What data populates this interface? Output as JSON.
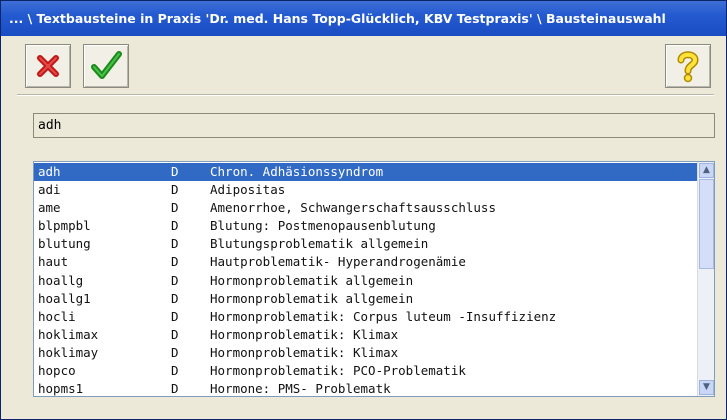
{
  "window": {
    "title": "... \\ Textbausteine in Praxis 'Dr. med. Hans Topp-Glücklich, KBV Testpraxis' \\ Bausteinauswahl"
  },
  "toolbar": {
    "cancel_icon": "red-x-icon",
    "confirm_icon": "green-check-icon",
    "help_icon": "yellow-question-icon"
  },
  "search": {
    "value": "adh"
  },
  "list": {
    "selected_index": 0,
    "items": [
      {
        "code": "adh",
        "type": "D",
        "text": "Chron. Adhäsionssyndrom"
      },
      {
        "code": "adi",
        "type": "D",
        "text": "Adipositas"
      },
      {
        "code": "ame",
        "type": "D",
        "text": "Amenorrhoe, Schwangerschaftsausschluss"
      },
      {
        "code": "blpmpbl",
        "type": "D",
        "text": "Blutung: Postmenopausenblutung"
      },
      {
        "code": "blutung",
        "type": "D",
        "text": "Blutungsproblematik allgemein"
      },
      {
        "code": "haut",
        "type": "D",
        "text": "Hautproblematik- Hyperandrogenämie"
      },
      {
        "code": "hoallg",
        "type": "D",
        "text": "Hormonproblematik allgemein"
      },
      {
        "code": "hoallg1",
        "type": "D",
        "text": "Hormonproblematik allgemein"
      },
      {
        "code": "hocli",
        "type": "D",
        "text": "Hormonproblematik: Corpus luteum -Insuffizienz"
      },
      {
        "code": "hoklimax",
        "type": "D",
        "text": "Hormonproblematik: Klimax"
      },
      {
        "code": "hoklimay",
        "type": "D",
        "text": "Hormonproblematik: Klimax"
      },
      {
        "code": "hopco",
        "type": "D",
        "text": "Hormonproblematik: PCO-Problematik"
      },
      {
        "code": "hopms1",
        "type": "D",
        "text": "Hormone: PMS- Problematk"
      }
    ]
  },
  "colors": {
    "titlebar": "#245ad0",
    "selection": "#316ac5"
  }
}
